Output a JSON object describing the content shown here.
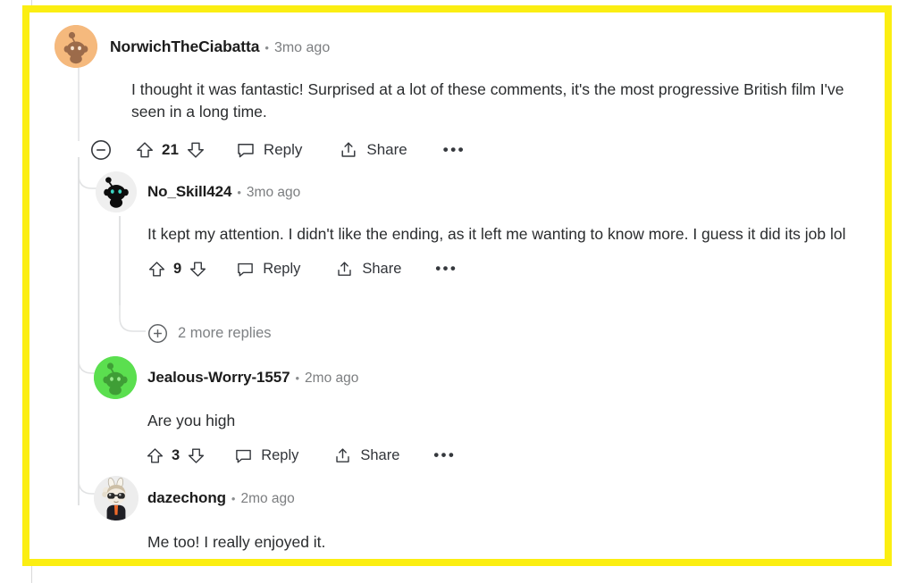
{
  "theme": {
    "highlight_color": "#fbee12",
    "background": "#ffffff",
    "text_color": "#2a2c2e",
    "meta_color": "#7c7e80",
    "thread_line_color": "#e1e2e3"
  },
  "comments": [
    {
      "username": "NorwichTheCiabatta",
      "separator": "•",
      "timestamp": "3mo ago",
      "body": "I thought it was fantastic! Surprised at a lot of these comments, it's the most progressive British film I've seen in a long time.",
      "avatar": "snoo-orange-avatar",
      "depth": 0,
      "collapse_icon": "minus-circle-icon",
      "actions": {
        "upvote_icon": "upvote-arrow-icon",
        "score": "21",
        "downvote_icon": "downvote-arrow-icon",
        "reply_icon": "speech-bubble-icon",
        "reply_label": "Reply",
        "share_icon": "share-arrow-icon",
        "share_label": "Share",
        "overflow_icon": "ellipsis-icon",
        "overflow_label": "•••"
      }
    },
    {
      "username": "No_Skill424",
      "separator": "•",
      "timestamp": "3mo ago",
      "body": "It kept my attention. I didn't like the ending, as it left me wanting to know more. I guess it did its job lol",
      "avatar": "snoo-black-avatar",
      "depth": 1,
      "actions": {
        "upvote_icon": "upvote-arrow-icon",
        "score": "9",
        "downvote_icon": "downvote-arrow-icon",
        "reply_icon": "speech-bubble-icon",
        "reply_label": "Reply",
        "share_icon": "share-arrow-icon",
        "share_label": "Share",
        "overflow_icon": "ellipsis-icon",
        "overflow_label": "•••"
      }
    },
    {
      "username": "Jealous-Worry-1557",
      "separator": "•",
      "timestamp": "2mo ago",
      "body": "Are you high",
      "avatar": "snoo-green-avatar",
      "depth": 1,
      "actions": {
        "upvote_icon": "upvote-arrow-icon",
        "score": "3",
        "downvote_icon": "downvote-arrow-icon",
        "reply_icon": "speech-bubble-icon",
        "reply_label": "Reply",
        "share_icon": "share-arrow-icon",
        "share_label": "Share",
        "overflow_icon": "ellipsis-icon",
        "overflow_label": "•••"
      }
    },
    {
      "username": "dazechong",
      "separator": "•",
      "timestamp": "2mo ago",
      "body": "Me too! I really enjoyed it.",
      "avatar": "bunny-sunglasses-avatar",
      "depth": 1
    }
  ],
  "more_replies": {
    "icon": "plus-circle-icon",
    "label": "2 more replies",
    "count": 2
  }
}
